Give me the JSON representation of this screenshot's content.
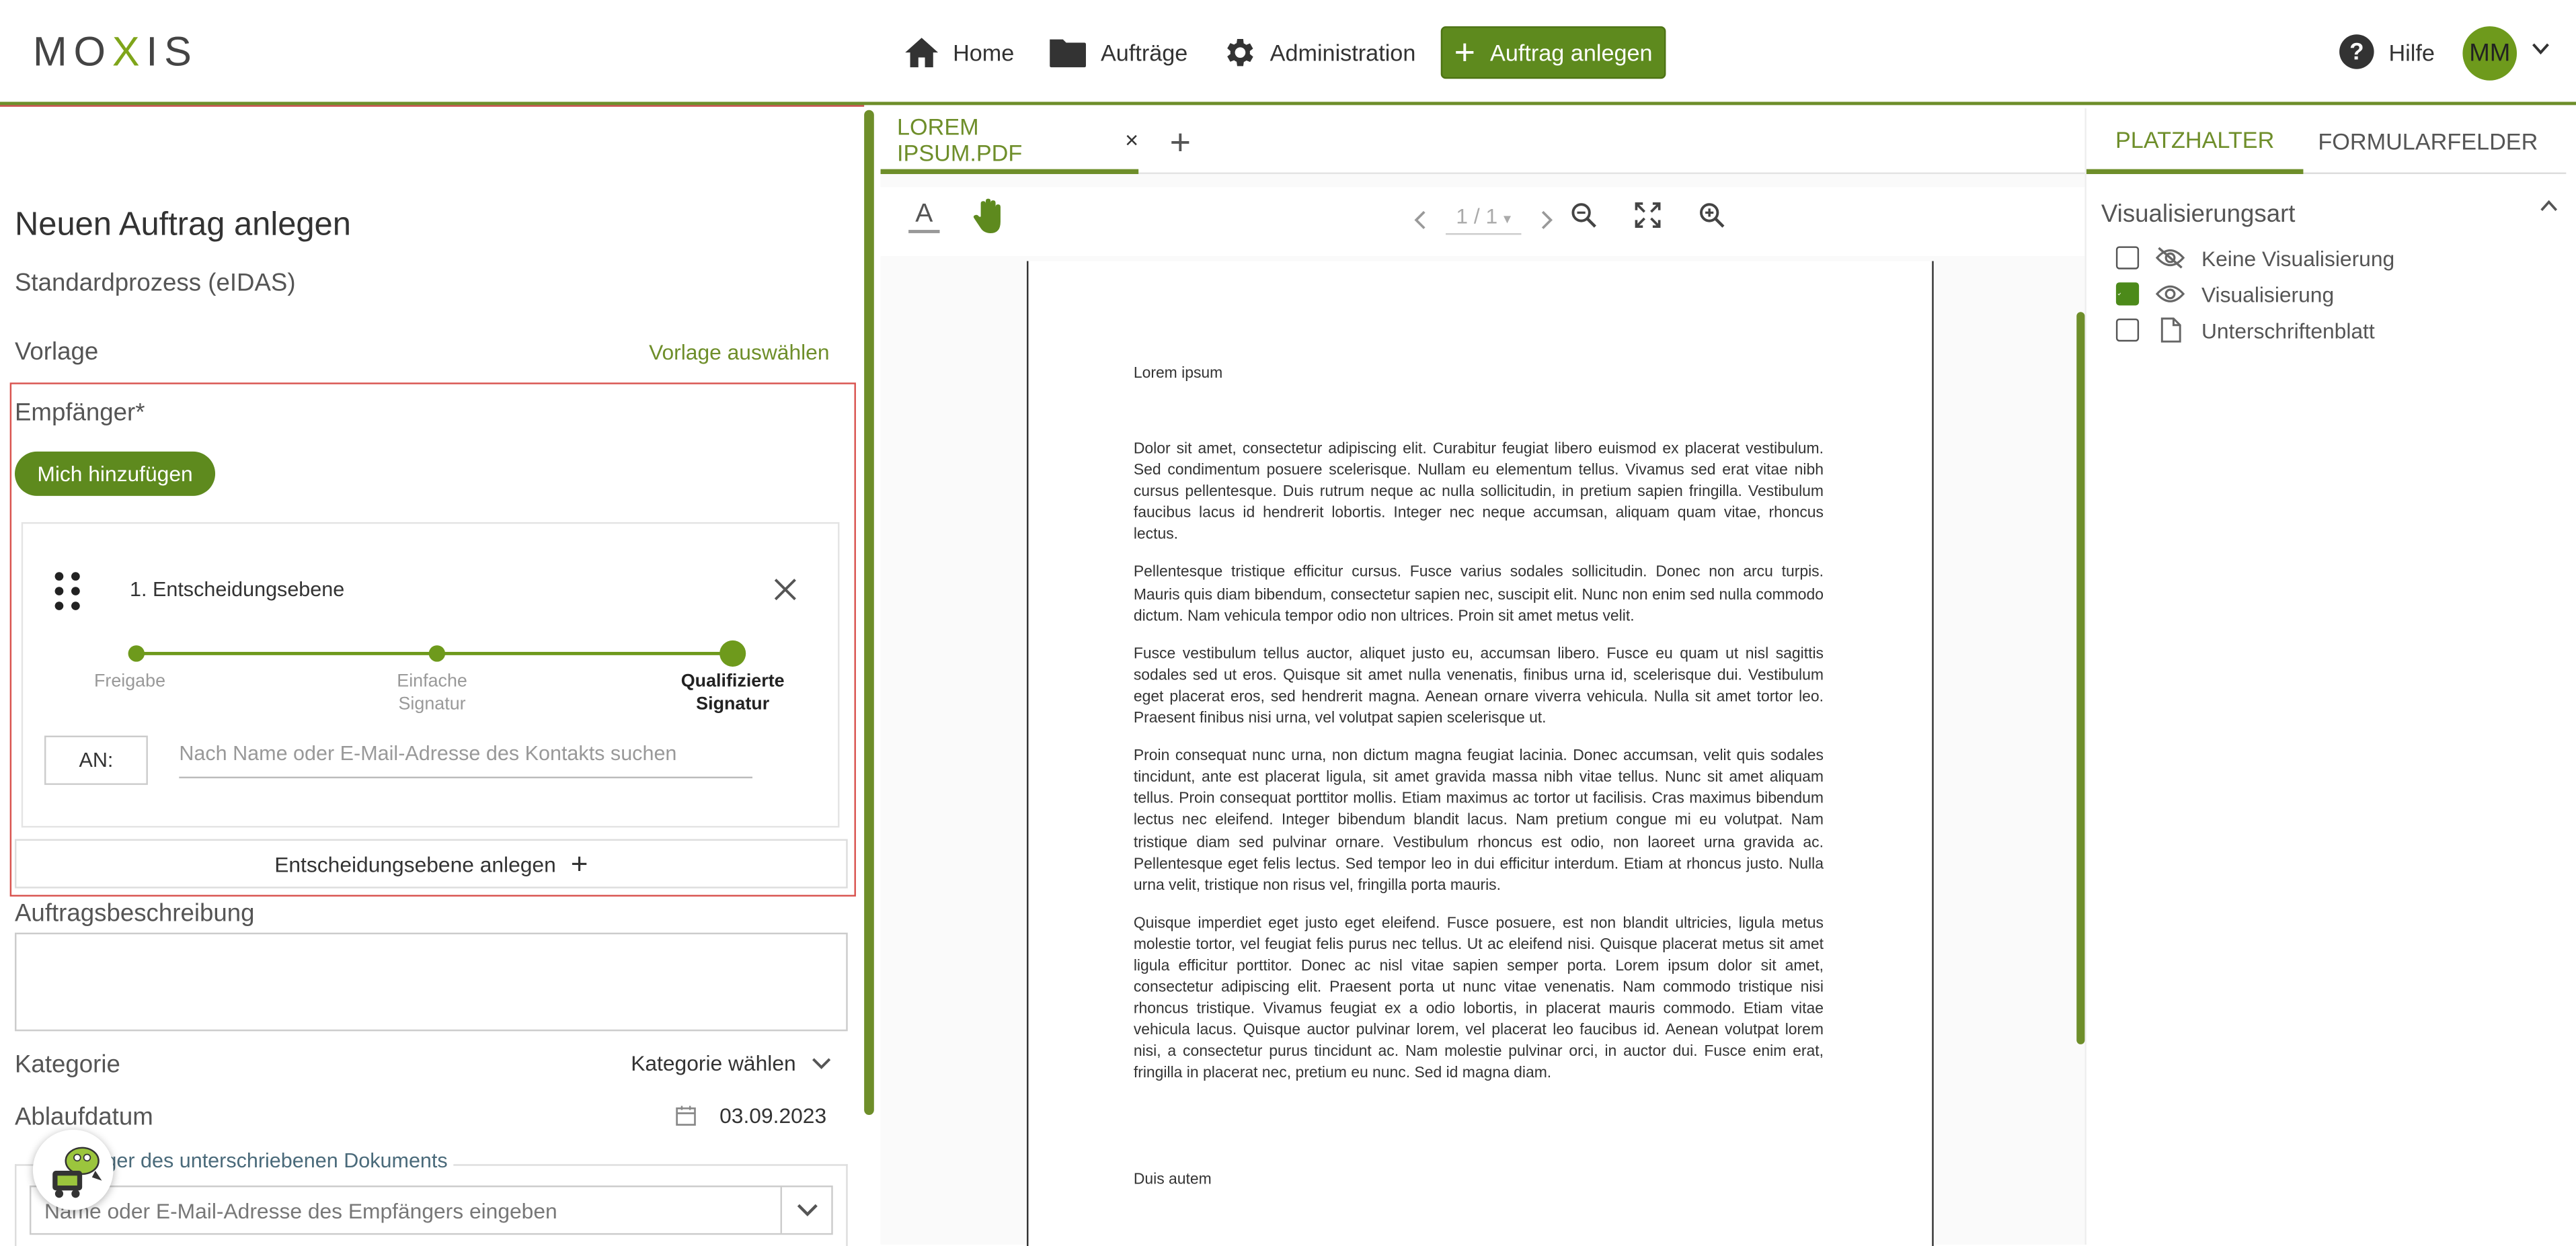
{
  "app": {
    "logo_left": "MO",
    "logo_x": "X",
    "logo_right": "IS"
  },
  "header": {
    "nav": [
      {
        "label": "Home",
        "icon": "home-icon"
      },
      {
        "label": "Aufträge",
        "icon": "folder-icon"
      },
      {
        "label": "Administration",
        "icon": "gear-icon"
      }
    ],
    "new_order_label": "Auftrag anlegen",
    "help_label": "Hilfe",
    "avatar_initials": "MM"
  },
  "form": {
    "title": "Neuen Auftrag anlegen",
    "subtitle": "Standardprozess (eIDAS)",
    "template_label": "Vorlage",
    "template_link": "Vorlage auswählen",
    "recipients_label": "Empfänger*",
    "add_me_label": "Mich hinzufügen",
    "level": {
      "title": "1. Entscheidungsebene",
      "steps": [
        {
          "line1": "Freigabe",
          "line2": "",
          "active": false
        },
        {
          "line1": "Einfache",
          "line2": "Signatur",
          "active": false
        },
        {
          "line1": "Qualifizierte",
          "line2": "Signatur",
          "active": true
        }
      ],
      "an_label": "AN:",
      "search_placeholder": "Nach Name oder E-Mail-Adresse des Kontakts suchen"
    },
    "add_level_label": "Entscheidungsebene anlegen",
    "description_label": "Auftragsbeschreibung",
    "category_label": "Kategorie",
    "category_value": "Kategorie wählen",
    "expiry_label": "Ablaufdatum",
    "expiry_value": "03.09.2023",
    "signed_doc_legend": "ger des unterschriebenen Dokuments",
    "signed_doc_placeholder": "Name oder E-Mail-Adresse des Empfängers eingeben"
  },
  "viewer": {
    "tab_label": "LOREM IPSUM.PDF",
    "tab_close": "×",
    "tab_add": "+",
    "text_tool": "A",
    "page_indicator": "1 / 1",
    "doc": {
      "heading": "Lorem ipsum",
      "paragraphs": [
        "Dolor sit amet, consectetur adipiscing elit. Curabitur feugiat libero euismod ex placerat vestibulum. Sed condimentum posuere scelerisque. Nullam eu elementum tellus. Vivamus sed erat vitae nibh cursus pellentesque. Duis rutrum neque ac nulla sollicitudin, in pretium sapien fringilla. Vestibulum faucibus lacus id hendrerit lobortis. Integer nec neque accumsan, aliquam quam vitae, rhoncus lectus.",
        "Pellentesque tristique efficitur cursus. Fusce varius sodales sollicitudin. Donec non arcu turpis. Mauris quis diam bibendum, consectetur sapien nec, suscipit elit. Nunc non enim sed nulla commodo dictum. Nam vehicula tempor odio non ultrices. Proin sit amet metus velit.",
        "Fusce vestibulum tellus auctor, aliquet justo eu, accumsan libero. Fusce eu quam ut nisl sagittis sodales sed ut eros. Quisque sit amet nulla venenatis, finibus urna id, scelerisque dui. Vestibulum eget placerat eros, sed hendrerit magna. Aenean ornare viverra vehicula. Nulla sit amet tortor leo. Praesent finibus nisi urna, vel volutpat sapien scelerisque ut.",
        "Proin consequat nunc urna, non dictum magna feugiat lacinia. Donec accumsan, velit quis sodales tincidunt, ante est placerat ligula, sit amet gravida massa nibh vitae tellus. Nunc sit amet aliquam tellus. Proin consequat porttitor mollis. Etiam maximus ac tortor ut facilisis. Cras maximus bibendum lectus nec eleifend. Integer bibendum blandit lacus. Nam pretium congue mi eu volutpat. Nam tristique diam sed pulvinar ornare. Vestibulum rhoncus est odio, non laoreet urna gravida ac. Pellentesque eget felis lectus. Sed tempor leo in dui efficitur interdum. Etiam at rhoncus justo. Nulla urna velit, tristique non risus vel, fringilla porta mauris.",
        "Quisque imperdiet eget justo eget eleifend. Fusce posuere, est non blandit ultricies, ligula metus molestie tortor, vel feugiat felis purus nec tellus. Ut ac eleifend nisi. Quisque placerat metus sit amet ligula efficitur porttitor. Donec ac nisl vitae sapien semper porta. Lorem ipsum dolor sit amet, consectetur adipiscing elit. Praesent porta ut nunc vitae venenatis. Nam commodo tristique nisi rhoncus tristique. Vivamus feugiat ex a odio lobortis, in placerat mauris commodo. Etiam vitae vehicula lacus. Quisque auctor pulvinar lorem, vel placerat leo faucibus id. Aenean volutpat lorem nisi, a consectetur purus tincidunt ac. Nam molestie pulvinar orci, in auctor dui. Fusce enim erat, fringilla in placerat nec, pretium eu nunc. Sed id magna diam."
      ],
      "footer_text": "Duis autem"
    }
  },
  "right_panel": {
    "tabs": [
      "PLATZHALTER",
      "FORMULARFELDER"
    ],
    "section_title": "Visualisierungsart",
    "options": [
      {
        "label": "Keine Visualisierung",
        "checked": false,
        "icon": "eye-off-icon"
      },
      {
        "label": "Visualisierung",
        "checked": true,
        "icon": "eye-icon"
      },
      {
        "label": "Unterschriftenblatt",
        "checked": false,
        "icon": "document-icon"
      }
    ]
  },
  "colors": {
    "accent": "#6e8e2a",
    "button": "#5e8a1e",
    "error_border": "#d9534f"
  }
}
